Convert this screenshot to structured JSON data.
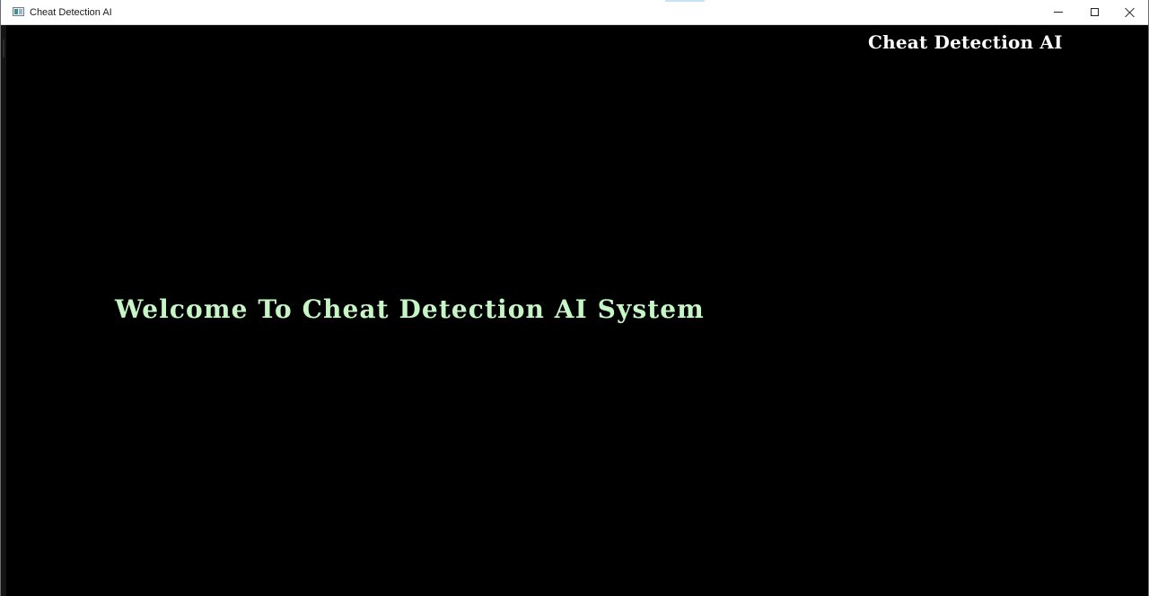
{
  "window": {
    "title": "Cheat Detection AI",
    "icon": "app-window-icon",
    "controls": {
      "minimize_icon": "minimize-icon",
      "maximize_icon": "maximize-icon",
      "close_icon": "close-icon"
    }
  },
  "app": {
    "brand_title": "Cheat Detection AI",
    "welcome_message": "Welcome To Cheat Detection AI System"
  },
  "colors": {
    "background": "#000000",
    "brand_title": "#ffffff",
    "welcome_text": "#c6f5c6",
    "titlebar": "#ffffff"
  }
}
